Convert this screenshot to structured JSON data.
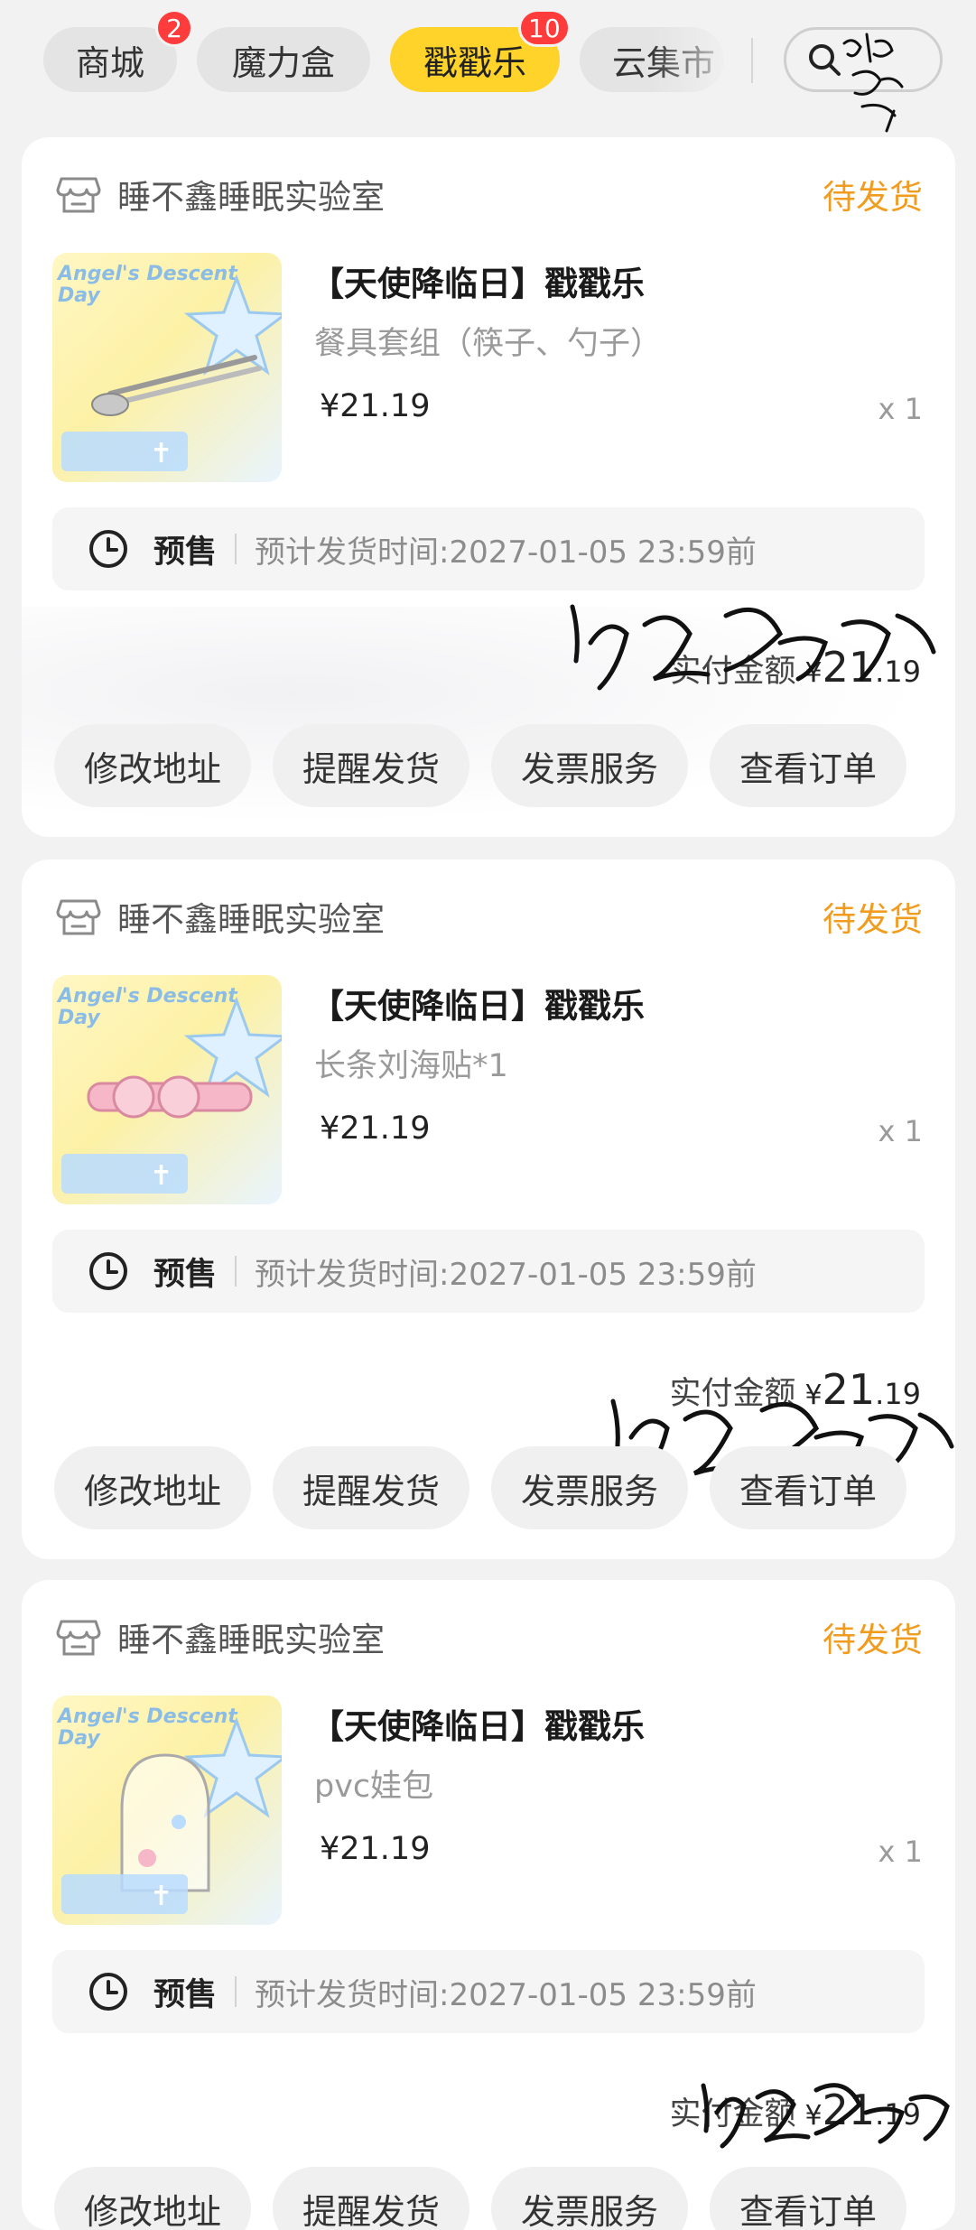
{
  "tabs": [
    {
      "label": "商城",
      "badge": "2"
    },
    {
      "label": "魔力盒",
      "badge": ""
    },
    {
      "label": "戳戳乐",
      "badge": "10"
    },
    {
      "label": "云集市",
      "badge": ""
    }
  ],
  "orders": [
    {
      "shop": "睡不鑫睡眠实验室",
      "status": "待发货",
      "title": "【天使降临日】戳戳乐",
      "subtitle": "餐具套组（筷子、勺子）",
      "price": "¥21.19",
      "qty": "x 1",
      "presale_tag": "预售",
      "presale_text": "预计发货时间:2027-01-05 23:59前",
      "paid_label": "实付金额",
      "paid_symbol": "¥",
      "paid_int": "21",
      "paid_dec": ".19",
      "actions": [
        "修改地址",
        "提醒发货",
        "发票服务",
        "查看订单"
      ]
    },
    {
      "shop": "睡不鑫睡眠实验室",
      "status": "待发货",
      "title": "【天使降临日】戳戳乐",
      "subtitle": "长条刘海贴*1",
      "price": "¥21.19",
      "qty": "x 1",
      "presale_tag": "预售",
      "presale_text": "预计发货时间:2027-01-05 23:59前",
      "paid_label": "实付金额",
      "paid_symbol": "¥",
      "paid_int": "21",
      "paid_dec": ".19",
      "actions": [
        "修改地址",
        "提醒发货",
        "发票服务",
        "查看订单"
      ]
    },
    {
      "shop": "睡不鑫睡眠实验室",
      "status": "待发货",
      "title": "【天使降临日】戳戳乐",
      "subtitle": "pvc娃包",
      "price": "¥21.19",
      "qty": "x 1",
      "presale_tag": "预售",
      "presale_text": "预计发货时间:2027-01-05 23:59前",
      "paid_label": "实付金额",
      "paid_symbol": "¥",
      "paid_int": "21",
      "paid_dec": ".19",
      "actions": [
        "修改地址",
        "提醒发货",
        "发票服务",
        "查看订单"
      ]
    }
  ],
  "thumb_brand": "Angel's Descent Day",
  "colors": {
    "accent": "#ffd32a",
    "badge": "#ff3b3b",
    "status": "#f29c1f"
  }
}
